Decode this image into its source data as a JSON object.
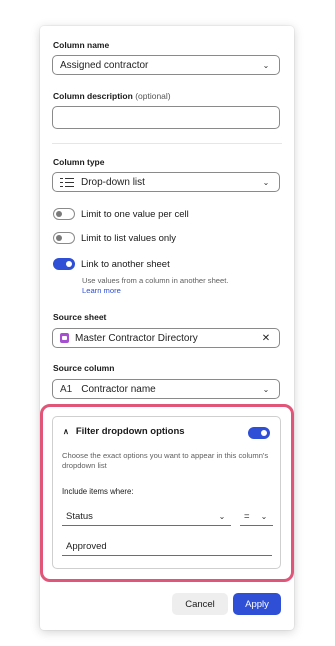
{
  "column_name": {
    "label": "Column name",
    "value": "Assigned contractor"
  },
  "column_description": {
    "label": "Column description",
    "optional": "(optional)",
    "value": ""
  },
  "column_type": {
    "label": "Column type",
    "value": "Drop-down list",
    "icon": "list-icon"
  },
  "options": {
    "limit_one": {
      "label": "Limit to one value per cell",
      "on": false
    },
    "limit_list": {
      "label": "Limit to list values only",
      "on": false
    },
    "link_sheet": {
      "label": "Link to another sheet",
      "on": true,
      "helper": "Use values from a column in another sheet.",
      "learn_more": "Learn more"
    }
  },
  "source_sheet": {
    "label": "Source sheet",
    "value": "Master Contractor Directory",
    "icon": "sheet-icon"
  },
  "source_column": {
    "label": "Source column",
    "value": "Contractor name",
    "icon": "A1"
  },
  "filter": {
    "title": "Filter dropdown options",
    "enabled": true,
    "description": "Choose the exact options you want to appear in this column's dropdown list",
    "include_label": "Include items where:",
    "field": "Status",
    "operator": "=",
    "value": "Approved"
  },
  "buttons": {
    "cancel": "Cancel",
    "apply": "Apply"
  },
  "colors": {
    "accent": "#2f4fd6",
    "highlight": "#e05578"
  }
}
